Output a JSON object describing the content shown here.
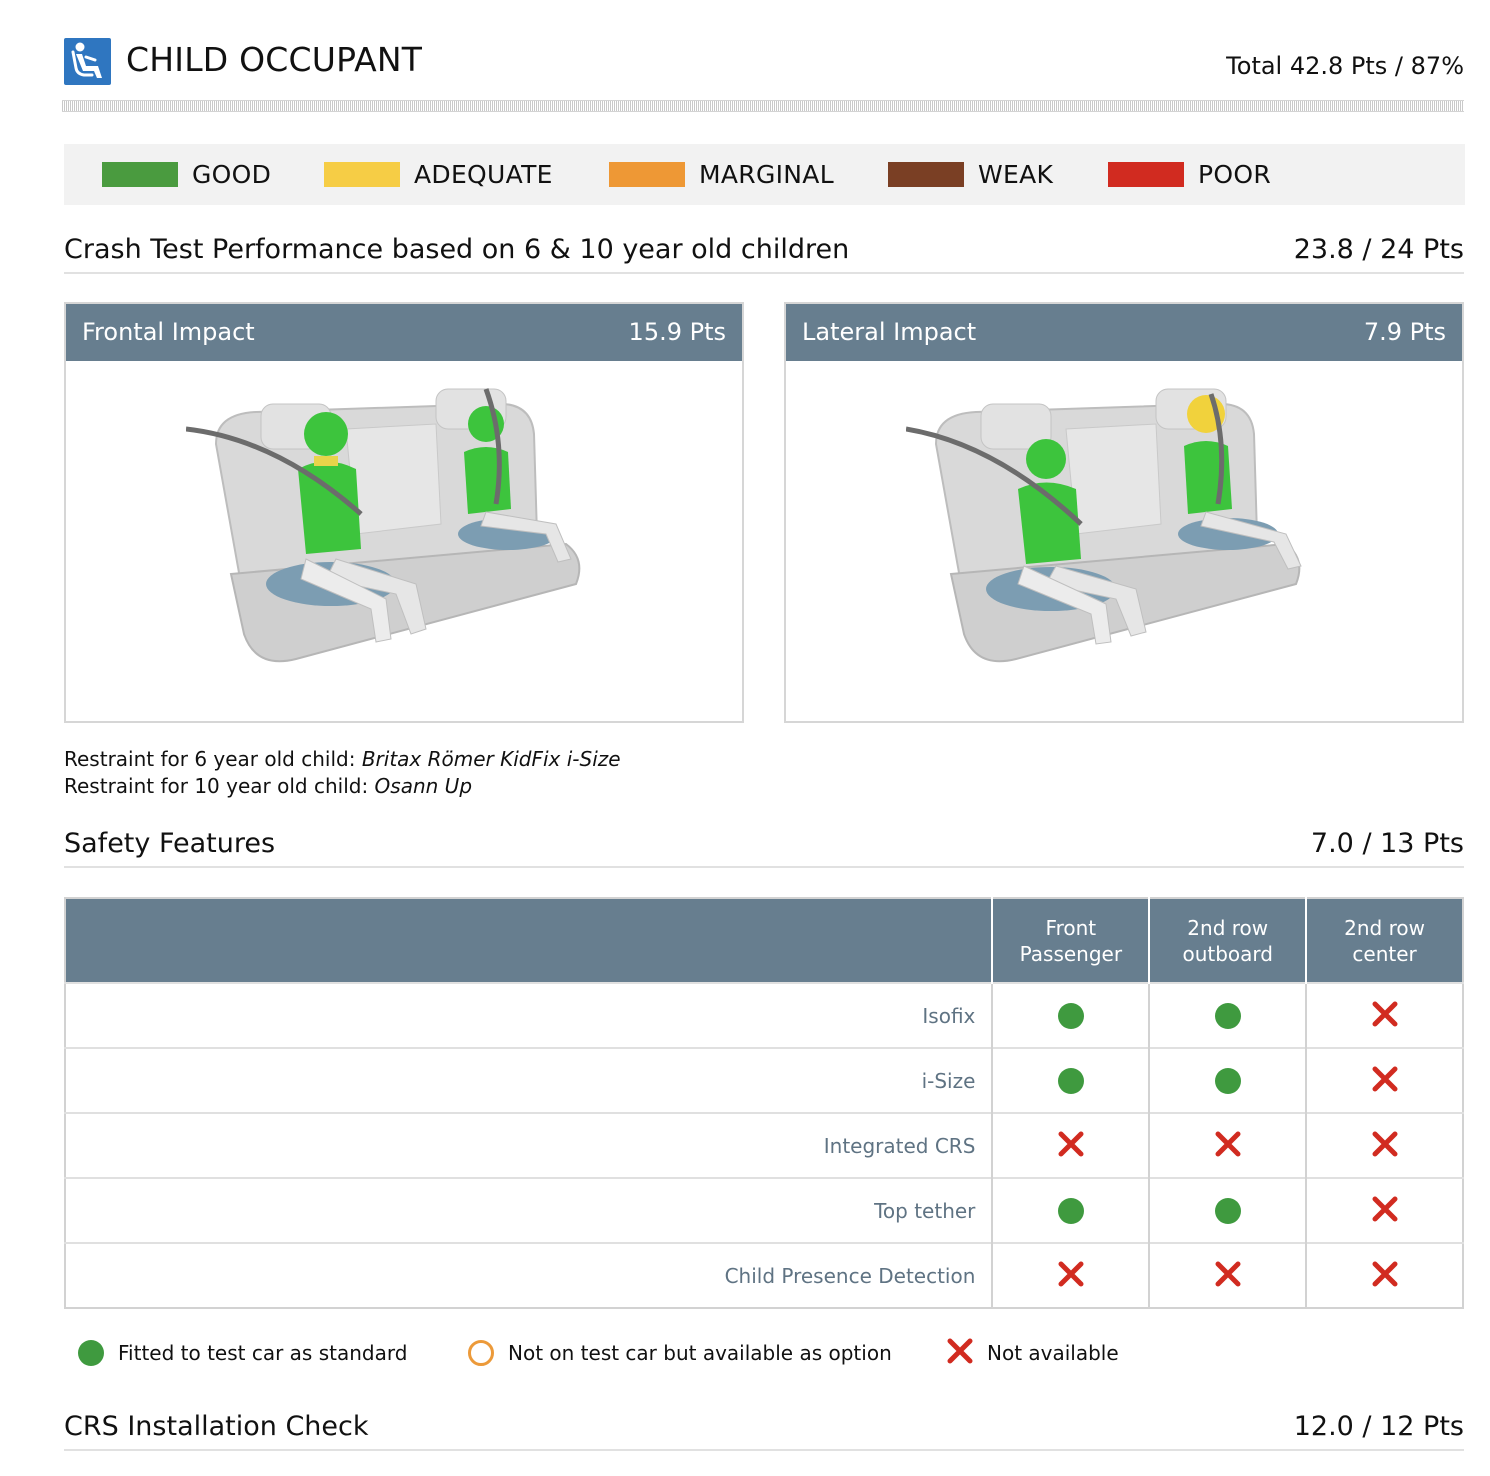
{
  "header": {
    "title": "CHILD OCCUPANT",
    "total": "Total 42.8 Pts / 87%",
    "icon": "child-seat-icon"
  },
  "rating_legend": [
    {
      "label": "GOOD",
      "color": "#4a9b3f"
    },
    {
      "label": "ADEQUATE",
      "color": "#f6cd45"
    },
    {
      "label": "MARGINAL",
      "color": "#ee9835"
    },
    {
      "label": "WEAK",
      "color": "#7a3f24"
    },
    {
      "label": "POOR",
      "color": "#d12b20"
    }
  ],
  "crash_test": {
    "title": "Crash Test Performance based on 6 & 10 year old children",
    "points": "23.8 / 24 Pts",
    "frontal": {
      "title": "Frontal Impact",
      "points": "15.9 Pts"
    },
    "lateral": {
      "title": "Lateral Impact",
      "points": "7.9 Pts"
    },
    "restraint_6": {
      "label": "Restraint for 6 year old child: ",
      "value": "Britax Römer KidFix i-Size"
    },
    "restraint_10": {
      "label": "Restraint for 10 year old child: ",
      "value": "Osann Up"
    }
  },
  "safety_features": {
    "title": "Safety Features",
    "points": "7.0 / 13 Pts",
    "columns": [
      {
        "line1": "Front",
        "line2": "Passenger"
      },
      {
        "line1": "2nd row",
        "line2": "outboard"
      },
      {
        "line1": "2nd row",
        "line2": "center"
      }
    ],
    "rows": [
      {
        "label": "Isofix",
        "values": [
          "standard",
          "standard",
          "not-available"
        ]
      },
      {
        "label": "i-Size",
        "values": [
          "standard",
          "standard",
          "not-available"
        ]
      },
      {
        "label": "Integrated CRS",
        "values": [
          "not-available",
          "not-available",
          "not-available"
        ]
      },
      {
        "label": "Top tether",
        "values": [
          "standard",
          "standard",
          "not-available"
        ]
      },
      {
        "label": "Child Presence Detection",
        "values": [
          "not-available",
          "not-available",
          "not-available"
        ]
      }
    ],
    "symbol_legend": {
      "standard": "Fitted to test car as standard",
      "option": "Not on test car but available as option",
      "not_available": "Not available"
    }
  },
  "crs_installation": {
    "title": "CRS Installation Check",
    "points": "12.0 / 12 Pts"
  }
}
